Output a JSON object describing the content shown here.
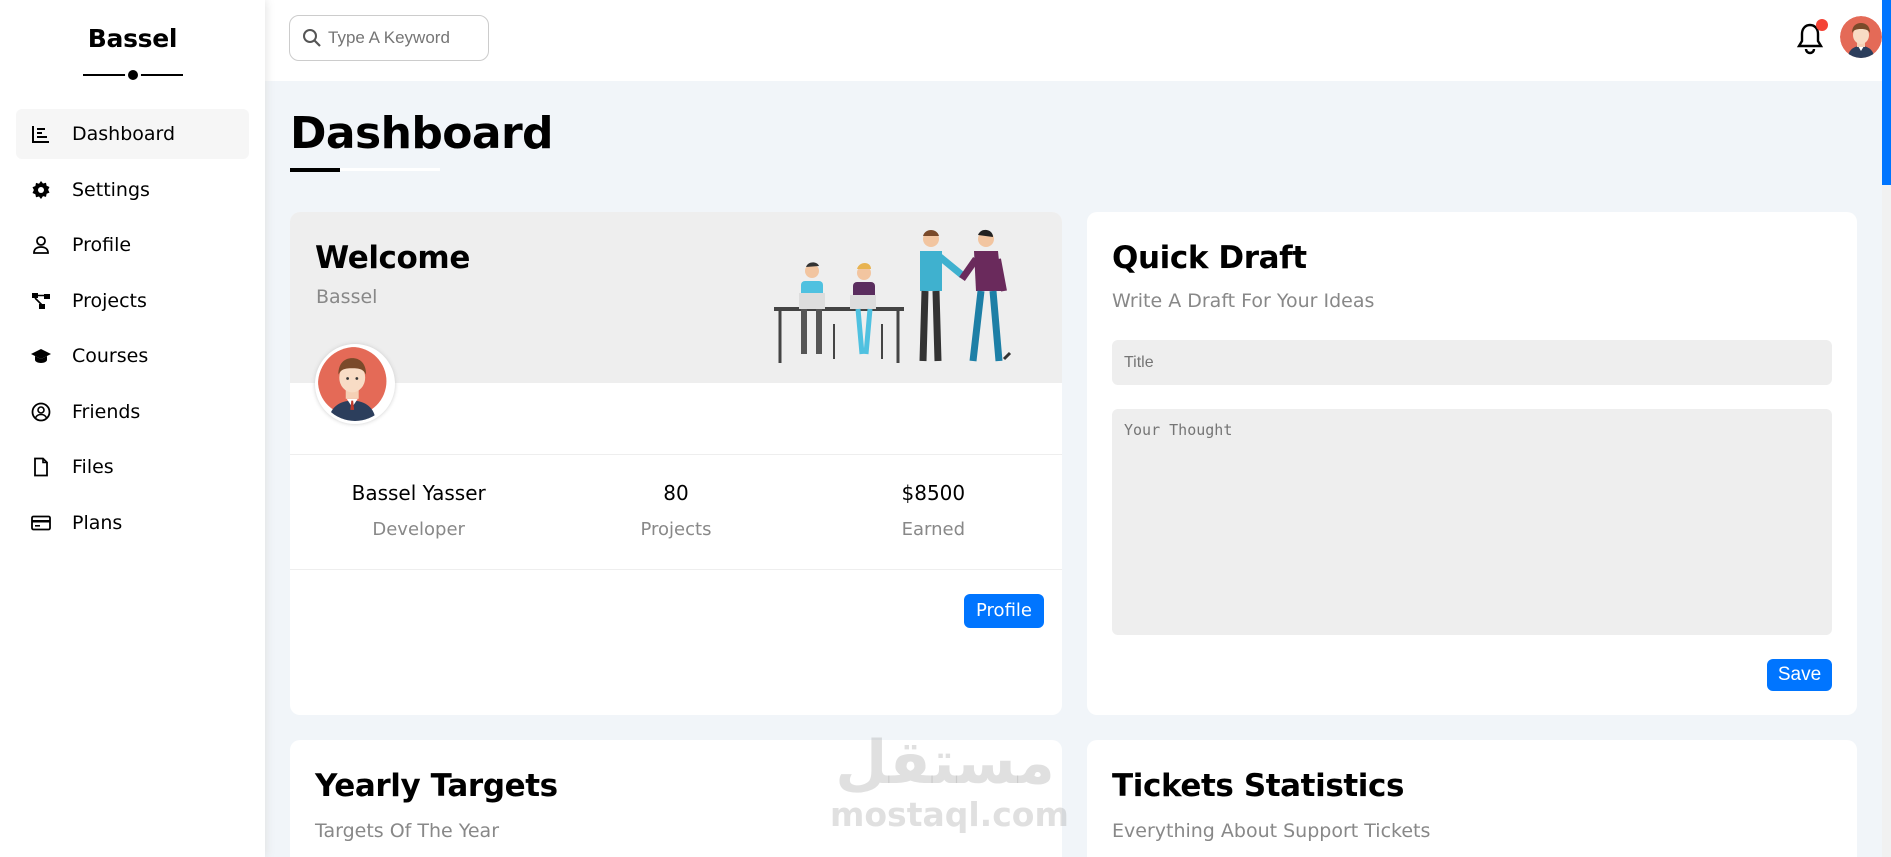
{
  "sidebar": {
    "brand": "Bassel",
    "items": [
      {
        "label": "Dashboard",
        "icon": "chart-icon",
        "active": true
      },
      {
        "label": "Settings",
        "icon": "gear-icon"
      },
      {
        "label": "Profile",
        "icon": "user-icon"
      },
      {
        "label": "Projects",
        "icon": "diagram-icon"
      },
      {
        "label": "Courses",
        "icon": "graduation-cap-icon"
      },
      {
        "label": "Friends",
        "icon": "user-circle-icon"
      },
      {
        "label": "Files",
        "icon": "file-icon"
      },
      {
        "label": "Plans",
        "icon": "credit-card-icon"
      }
    ]
  },
  "header": {
    "search_placeholder": "Type A Keyword",
    "notification_badge": true
  },
  "page": {
    "title": "Dashboard"
  },
  "welcome": {
    "title": "Welcome",
    "subtitle": "Bassel",
    "stats": [
      {
        "value": "Bassel Yasser",
        "label": "Developer"
      },
      {
        "value": "80",
        "label": "Projects"
      },
      {
        "value": "$8500",
        "label": "Earned"
      }
    ],
    "button": "Profile"
  },
  "draft": {
    "title": "Quick Draft",
    "subtitle": "Write A Draft For Your Ideas",
    "title_placeholder": "Title",
    "thought_placeholder": "Your Thought",
    "button": "Save"
  },
  "targets": {
    "title": "Yearly Targets",
    "subtitle": "Targets Of The Year"
  },
  "tickets": {
    "title": "Tickets Statistics",
    "subtitle": "Everything About Support Tickets"
  },
  "watermark": {
    "arabic": "مستقل",
    "latin": "mostaql.com"
  },
  "colors": {
    "accent": "#0075ff",
    "background": "#f1f5f9",
    "badge": "#f44336"
  }
}
